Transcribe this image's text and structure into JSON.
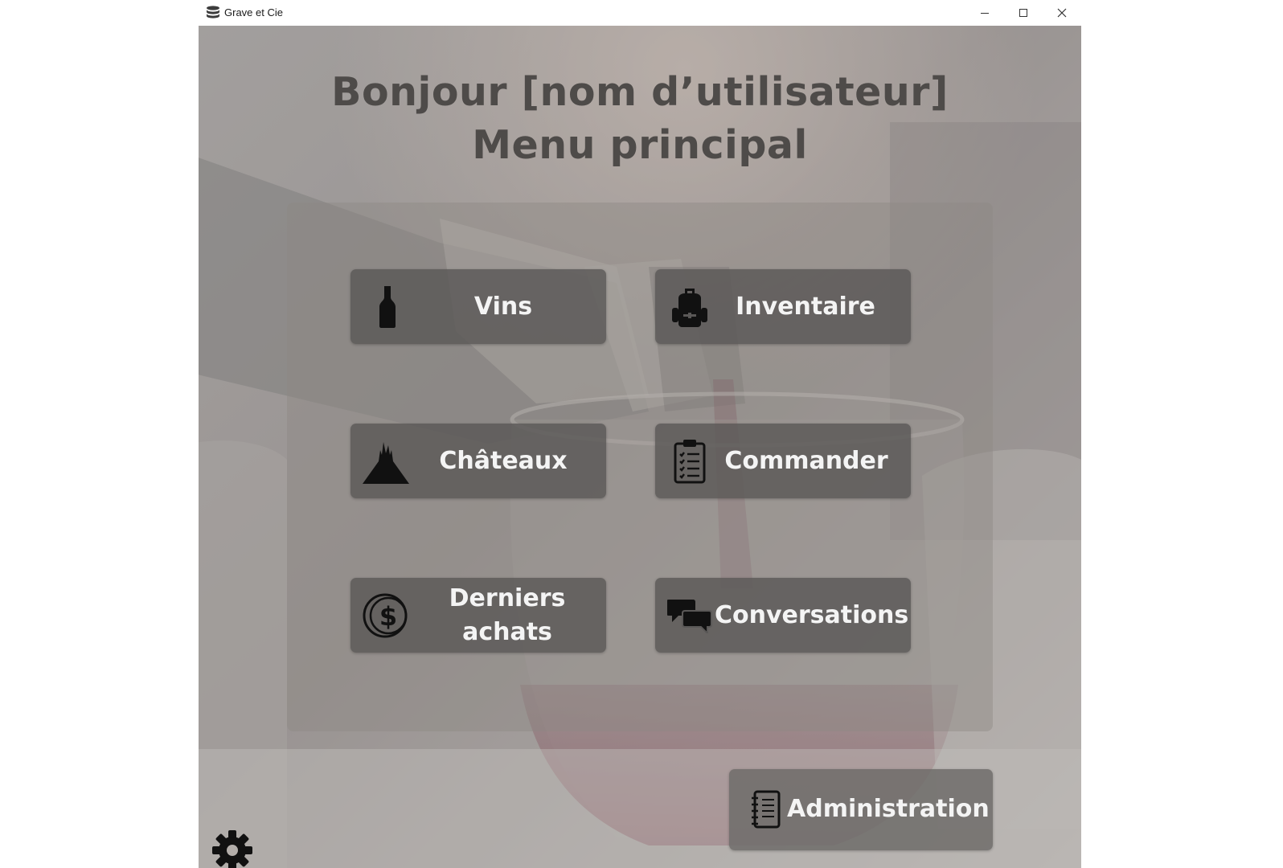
{
  "window": {
    "title": "Grave et Cie",
    "controls": [
      "minimize",
      "maximize",
      "close"
    ]
  },
  "heading": {
    "line1": "Bonjour [nom d’utilisateur]",
    "line2": "Menu principal"
  },
  "menu": {
    "vins": {
      "label": "Vins",
      "icon": "wine-bottle-icon"
    },
    "inventaire": {
      "label": "Inventaire",
      "icon": "backpack-icon"
    },
    "chateaux": {
      "label": "Châteaux",
      "icon": "castle-icon"
    },
    "commander": {
      "label": "Commander",
      "icon": "clipboard-checklist-icon"
    },
    "derniers_achats": {
      "label_line1": "Derniers",
      "label_line2": "achats",
      "icon": "dollar-coin-icon"
    },
    "conversations": {
      "label": "Conversations",
      "icon": "chat-bubbles-icon"
    }
  },
  "administration": {
    "label": "Administration",
    "icon": "notebook-icon"
  },
  "settings": {
    "icon": "gear-icon"
  },
  "colors": {
    "heading": "#4e4b49",
    "button_bg": "#5a5857",
    "button_text": "#f4f4f4",
    "panel": "#8c8884"
  }
}
